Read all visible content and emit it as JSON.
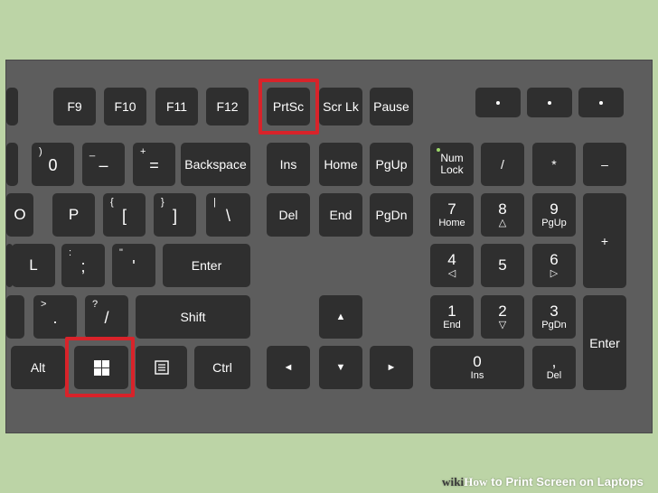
{
  "keys": {
    "f9": "F9",
    "f10": "F10",
    "f11": "F11",
    "f12": "F12",
    "prtsc": "PrtSc",
    "scrlk": "Scr Lk",
    "pause": "Pause",
    "zero": "0",
    "zero_top": ")",
    "minus": "–",
    "minus_top": "_",
    "equals": "=",
    "equals_top": "+",
    "backspace": "Backspace",
    "ins": "Ins",
    "home": "Home",
    "pgup": "PgUp",
    "numlock_1": "Num",
    "numlock_2": "Lock",
    "num_slash": "/",
    "num_star": "*",
    "num_minus": "–",
    "o": "O",
    "p": "P",
    "lbracket": "[",
    "lbracket_top": "{",
    "rbracket": "]",
    "rbracket_top": "}",
    "backslash": "\\",
    "backslash_top": "|",
    "del": "Del",
    "end": "End",
    "pgdn": "PgDn",
    "num7": "7",
    "num7_sub": "Home",
    "num8": "8",
    "num8_sub": "△",
    "num9": "9",
    "num9_sub": "PgUp",
    "num_plus": "+",
    "l": "L",
    "semicolon": ";",
    "semicolon_top": ":",
    "quote": "'",
    "quote_top": "\"",
    "enter": "Enter",
    "num4": "4",
    "num4_sub": "◁",
    "num5": "5",
    "num6": "6",
    "num6_sub": "▷",
    "period": ".",
    "period_top": ">",
    "slash": "/",
    "slash_top": "?",
    "shift": "Shift",
    "up": "▲",
    "num1": "1",
    "num1_sub": "End",
    "num2": "2",
    "num2_sub": "▽",
    "num3": "3",
    "num3_sub": "PgDn",
    "num_enter": "Enter",
    "alt": "Alt",
    "ctrl": "Ctrl",
    "left": "◄",
    "down": "▼",
    "right": "►",
    "num0": "0",
    "num0_sub": "Ins",
    "num_dot": ",",
    "num_dot_sub": "Del"
  },
  "icons": {
    "windows": "windows-logo-icon",
    "menu": "context-menu-icon"
  },
  "highlight_color": "#d8232a",
  "caption": {
    "brand_a": "wiki",
    "brand_b": "How",
    "text": " to Print Screen on Laptops"
  }
}
